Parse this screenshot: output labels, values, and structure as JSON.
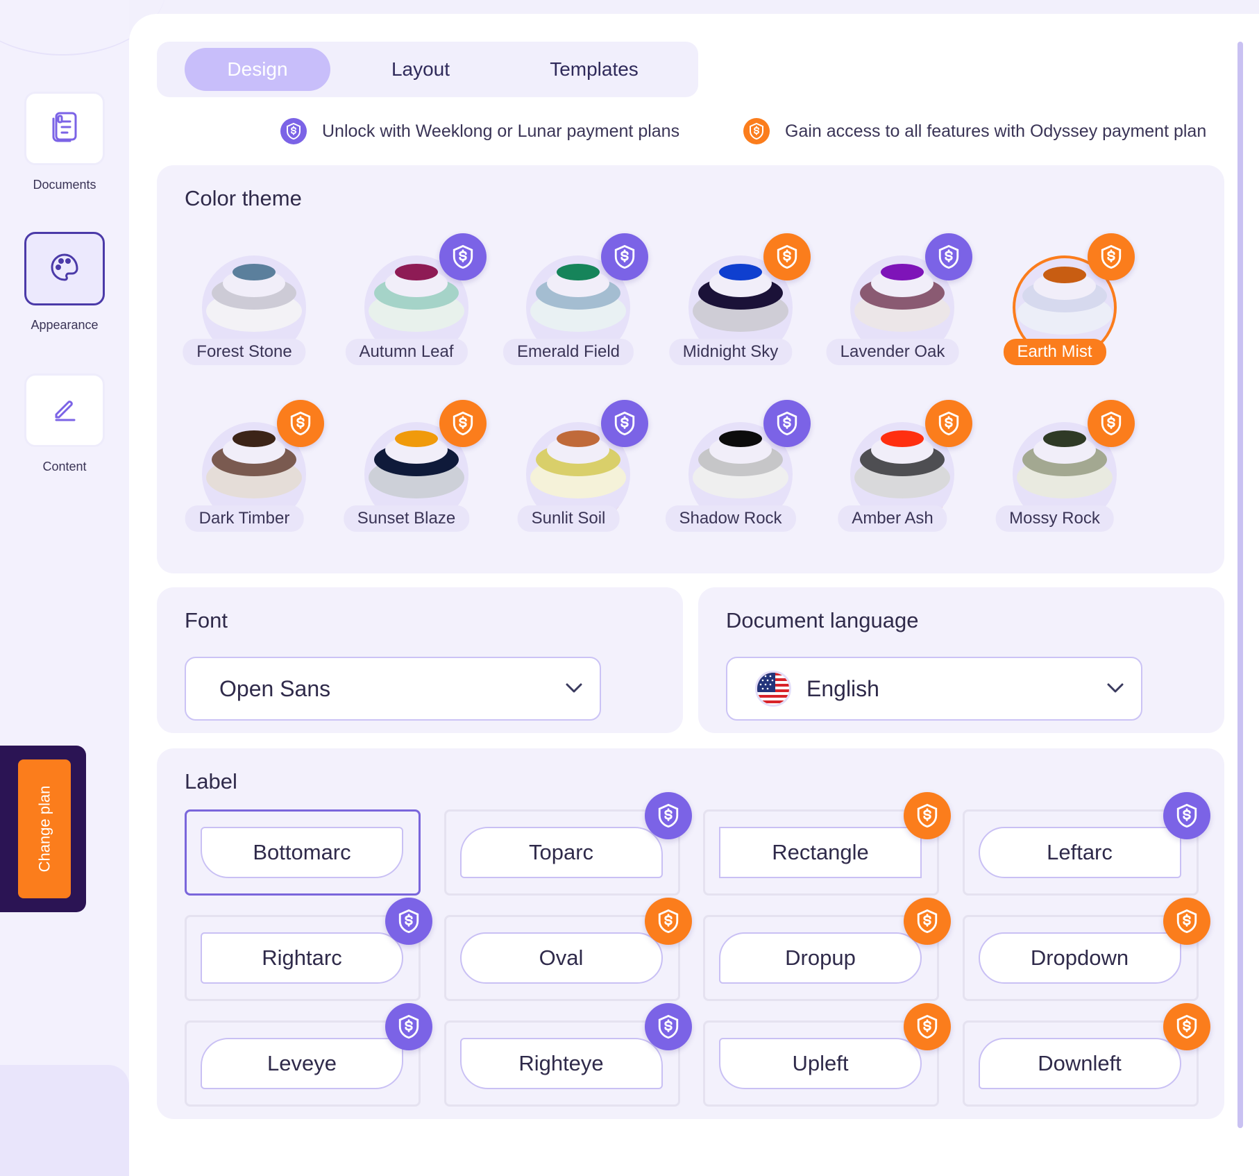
{
  "sidebar": {
    "items": [
      {
        "label": "Documents",
        "icon": "documents-icon",
        "active": false
      },
      {
        "label": "Appearance",
        "icon": "palette-icon",
        "active": true
      },
      {
        "label": "Content",
        "icon": "pencil-icon",
        "active": false
      }
    ],
    "change_plan_label": "Change plan"
  },
  "tabs": [
    {
      "label": "Design",
      "active": true
    },
    {
      "label": "Layout",
      "active": false
    },
    {
      "label": "Templates",
      "active": false
    }
  ],
  "legend": {
    "weeklong": "Unlock with Weeklong or Lunar payment plans",
    "odyssey": "Gain access to all features with Odyssey payment plan"
  },
  "color_theme": {
    "title": "Color theme",
    "selected": "Earth Mist",
    "themes": [
      {
        "name": "Forest Stone",
        "badge": null,
        "colors": [
          "#5b7f9c",
          "#cdcbd6",
          "#f3f2f6",
          "#5e86a0"
        ]
      },
      {
        "name": "Autumn Leaf",
        "badge": "purple",
        "colors": [
          "#8e1b55",
          "#a5d3c8",
          "#e8f1ec",
          "#8e1b55"
        ]
      },
      {
        "name": "Emerald Field",
        "badge": "purple",
        "colors": [
          "#16845a",
          "#a4bdd1",
          "#e9f1f3",
          "#16845a"
        ]
      },
      {
        "name": "Midnight Sky",
        "badge": "orange",
        "colors": [
          "#0f3fcf",
          "#1b1238",
          "#cfcdd6",
          "#0f3fcf"
        ]
      },
      {
        "name": "Lavender Oak",
        "badge": "purple",
        "colors": [
          "#7e14b8",
          "#8a5a72",
          "#ece6e8",
          "#7e14b8"
        ]
      },
      {
        "name": "Earth Mist",
        "badge": "orange",
        "colors": [
          "#c85d12",
          "#d6d9ee",
          "#eceef8",
          "#c85d12"
        ]
      },
      {
        "name": "Dark Timber",
        "badge": "orange",
        "colors": [
          "#3c2418",
          "#7a5a50",
          "#e5ddd8",
          "#3c2418"
        ]
      },
      {
        "name": "Sunset Blaze",
        "badge": "orange",
        "colors": [
          "#f09a0b",
          "#0f1a3a",
          "#cdd0d8",
          "#f09a0b"
        ]
      },
      {
        "name": "Sunlit Soil",
        "badge": "purple",
        "colors": [
          "#c06a3a",
          "#d9cf6a",
          "#f5f2d9",
          "#c06a3a"
        ]
      },
      {
        "name": "Shadow Rock",
        "badge": "purple",
        "colors": [
          "#0c0c0c",
          "#c6c6c8",
          "#efefef",
          "#0c0c0c"
        ]
      },
      {
        "name": "Amber Ash",
        "badge": "orange",
        "colors": [
          "#ff2f10",
          "#4e4e52",
          "#d9d9db",
          "#ff2f10"
        ]
      },
      {
        "name": "Mossy Rock",
        "badge": "orange",
        "colors": [
          "#2f3a26",
          "#a3a891",
          "#e9eae0",
          "#2f3a26"
        ]
      }
    ]
  },
  "font": {
    "title": "Font",
    "value": "Open Sans"
  },
  "language": {
    "title": "Document language",
    "value": "English",
    "flag": "us-flag-icon"
  },
  "label": {
    "title": "Label",
    "selected": "Bottomarc",
    "options": [
      {
        "name": "Bottomarc",
        "badge": null,
        "shape": "bottomarc"
      },
      {
        "name": "Toparc",
        "badge": "purple",
        "shape": "toparc"
      },
      {
        "name": "Rectangle",
        "badge": "orange",
        "shape": "rectangle"
      },
      {
        "name": "Leftarc",
        "badge": "purple",
        "shape": "leftarc"
      },
      {
        "name": "Rightarc",
        "badge": "purple",
        "shape": "rightarc"
      },
      {
        "name": "Oval",
        "badge": "orange",
        "shape": "oval"
      },
      {
        "name": "Dropup",
        "badge": "orange",
        "shape": "dropup"
      },
      {
        "name": "Dropdown",
        "badge": "orange",
        "shape": "dropdown"
      },
      {
        "name": "Leveye",
        "badge": "purple",
        "shape": "leveye"
      },
      {
        "name": "Righteye",
        "badge": "purple",
        "shape": "righteye"
      },
      {
        "name": "Upleft",
        "badge": "orange",
        "shape": "upleft"
      },
      {
        "name": "Downleft",
        "badge": "orange",
        "shape": "downleft"
      }
    ]
  },
  "colors": {
    "accent_purple": "#7b63e6",
    "accent_orange": "#fb7d1c",
    "tab_active": "#c8befa",
    "plan_dark": "#2b1454"
  }
}
